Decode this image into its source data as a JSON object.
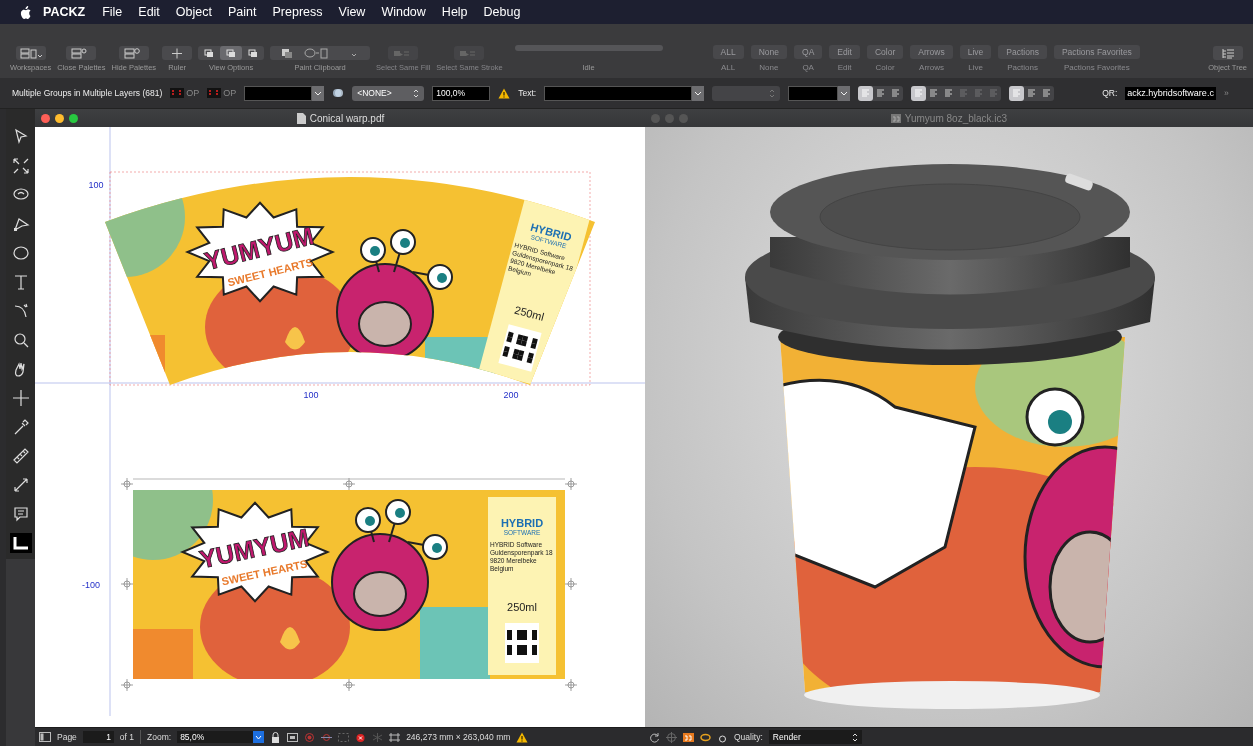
{
  "menu_bar": {
    "app": "PACKZ",
    "items": [
      "File",
      "Edit",
      "Object",
      "Paint",
      "Prepress",
      "View",
      "Window",
      "Help",
      "Debug"
    ]
  },
  "toolbar": [
    {
      "kind": "button",
      "label": "Workspaces",
      "disabled": false
    },
    {
      "kind": "button",
      "label": "Close Palettes",
      "disabled": false
    },
    {
      "kind": "button",
      "label": "Hide Palettes",
      "disabled": false
    },
    {
      "kind": "button",
      "label": "Ruler",
      "disabled": false
    },
    {
      "kind": "segmented",
      "label": "View Options",
      "segments": [
        {
          "selected": false
        },
        {
          "selected": true
        },
        {
          "selected": false
        }
      ]
    },
    {
      "kind": "clipboard",
      "label": "Paint Clipboard",
      "disabled": false
    },
    {
      "kind": "button",
      "label": "Select Same Fill",
      "disabled": true
    },
    {
      "kind": "button",
      "label": "Select Same Stroke",
      "disabled": true
    },
    {
      "kind": "progress",
      "label": "Idle",
      "level": 0
    }
  ],
  "presets": [
    {
      "button": "ALL",
      "caption": "ALL"
    },
    {
      "button": "None",
      "caption": "None"
    },
    {
      "button": "QA",
      "caption": "QA"
    },
    {
      "button": "Edit",
      "caption": "Edit"
    },
    {
      "button": "Color",
      "caption": "Color"
    },
    {
      "button": "Arrows",
      "caption": "Arrows"
    },
    {
      "button": "Live",
      "caption": "Live"
    },
    {
      "button": "Pactions",
      "caption": "Pactions"
    },
    {
      "button": "Pactions Favorites",
      "caption": "Pactions Favorites"
    }
  ],
  "object_tree": {
    "label": "Object Tree"
  },
  "properties": {
    "selection": "Multiple Groups in Multiple Layers (681)",
    "overprint": [
      "OP",
      "OP"
    ],
    "spot": "<NONE>",
    "tint": "100,0%",
    "text_label": "Text:",
    "text_direction": [
      {
        "selected": true
      },
      {
        "selected": false
      },
      {
        "selected": false
      }
    ],
    "alignment": [
      {
        "selected": true,
        "disabled": false
      },
      {
        "selected": false,
        "disabled": false
      },
      {
        "selected": false,
        "disabled": false
      },
      {
        "selected": false,
        "disabled": true
      },
      {
        "selected": false,
        "disabled": true
      },
      {
        "selected": false,
        "disabled": true
      }
    ],
    "placement": [
      {
        "selected": true
      },
      {
        "selected": false
      },
      {
        "selected": false
      }
    ],
    "qr_label": "QR:",
    "qr_value": "ackz.hybridsoftware.c",
    "more": "»"
  },
  "document_window": {
    "title": "Conical warp.pdf",
    "active": true,
    "rulers": [
      "100",
      "100",
      "200",
      "-100"
    ],
    "designs": [
      {
        "kind": "warped",
        "brand": "YUMYUM",
        "tagline": "SWEET HEARTS",
        "logo": "HYBRID",
        "logo_sub": "SOFTWARE",
        "address": [
          "HYBRID Software",
          "Guldensporenpark 18",
          "9820 Merelbeke",
          "Belgium"
        ],
        "volume": "250ml"
      },
      {
        "kind": "flat",
        "brand": "YUMYUM",
        "tagline": "SWEET HEARTS",
        "logo": "HYBRID",
        "logo_sub": "SOFTWARE",
        "address": [
          "HYBRID Software",
          "Guldensporenpark 18",
          "9820 Merelbeke",
          "Belgium"
        ],
        "volume": "250ml"
      }
    ],
    "status": {
      "page_label": "Page",
      "page": "1",
      "page_count": "of 1",
      "zoom_label": "Zoom:",
      "zoom": "85,0%",
      "dimensions": "246,273 mm × 263,040 mm"
    }
  },
  "preview_window": {
    "title": "Yumyum 8oz_black.ic3",
    "active": false,
    "status": {
      "quality_label": "Quality:",
      "quality": "Render"
    }
  }
}
